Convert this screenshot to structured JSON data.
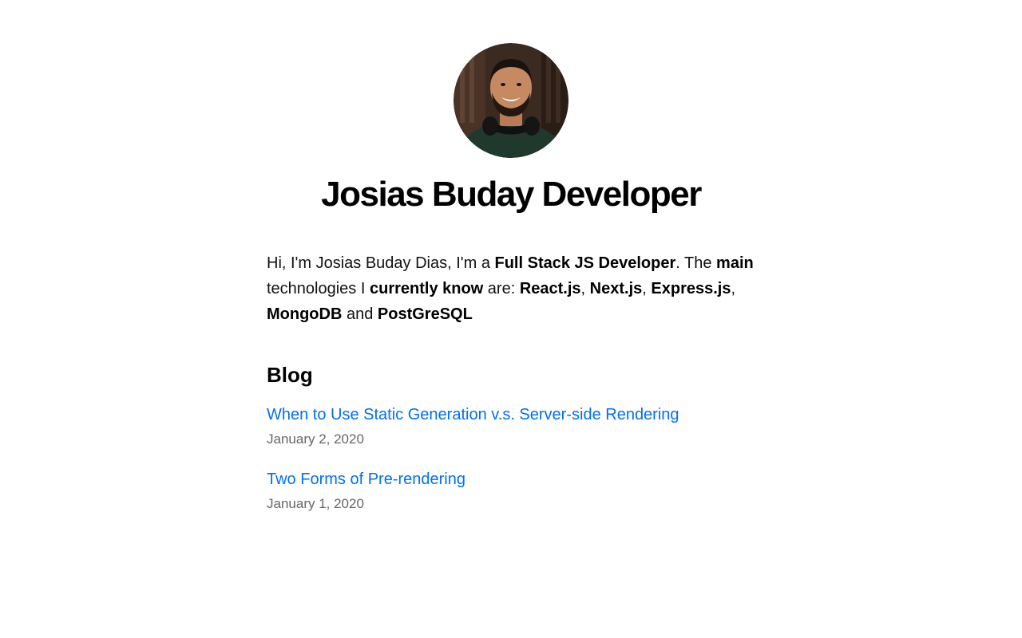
{
  "header": {
    "title": "Josias Buday Developer",
    "avatar_icon": "profile-photo"
  },
  "intro": {
    "s1": "Hi, I'm Josias Buday Dias, I'm a ",
    "b1": "Full Stack JS Developer",
    "s2": ". The ",
    "b2": "main",
    "s3": " technologies I ",
    "b3": "currently know",
    "s4": " are: ",
    "b4": "React.js",
    "s5": ", ",
    "b5": "Next.js",
    "s6": ", ",
    "b6": "Express.js",
    "s7": ", ",
    "b7": "MongoDB",
    "s8": " and ",
    "b8": "PostGreSQL"
  },
  "blog": {
    "heading": "Blog",
    "posts": [
      {
        "title": "When to Use Static Generation v.s. Server-side Rendering",
        "date": "January 2, 2020"
      },
      {
        "title": "Two Forms of Pre-rendering",
        "date": "January 1, 2020"
      }
    ]
  },
  "colors": {
    "link": "#0070f3",
    "date": "#666666",
    "text": "#111111"
  }
}
